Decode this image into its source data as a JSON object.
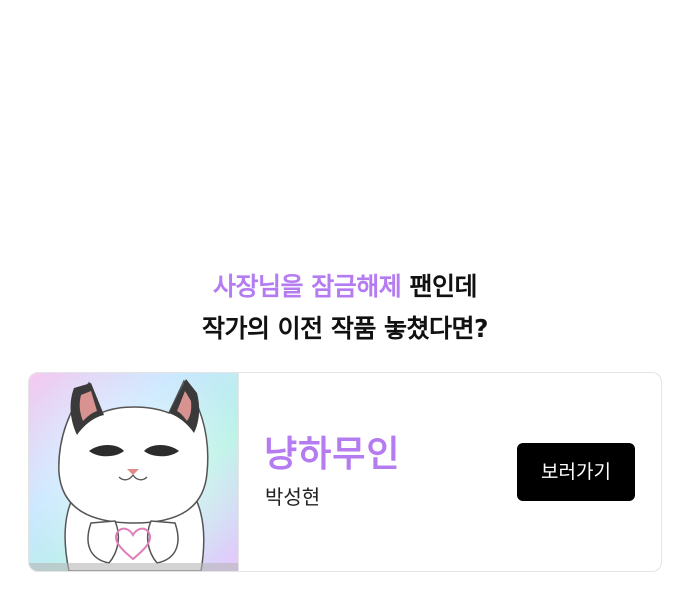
{
  "promo": {
    "line1_accent": "사장님을 잠금해제",
    "line1_rest": " 팬인데",
    "line2": "작가의 이전 작품 놓쳤다면?"
  },
  "work": {
    "title": "냥하무인",
    "author": "박성현",
    "button_label": "보러가기",
    "thumbnail_icon": "white-cat-heart-hands-thumbnail"
  },
  "colors": {
    "accent": "#b57cf2",
    "button_bg": "#000000",
    "button_text": "#ffffff",
    "card_border": "#e4e4e4"
  }
}
